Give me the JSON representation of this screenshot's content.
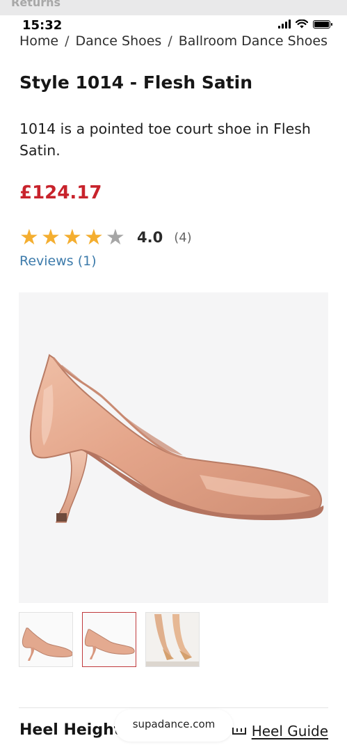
{
  "returns_banner": "Returns",
  "status_bar": {
    "time": "15:32"
  },
  "breadcrumb": {
    "items": [
      "Home",
      "Dance Shoes",
      "Ballroom Dance Shoes"
    ],
    "separator": "/"
  },
  "product": {
    "title": "Style 1014 - Flesh Satin",
    "description": "1014 is a pointed toe court shoe in Flesh Satin.",
    "price": "£124.17",
    "price_color": "#c8232c",
    "rating": {
      "value": "4.0",
      "count": "(4)",
      "stars_filled": 4,
      "stars_total": 5,
      "star_color": "#f4ae30"
    },
    "reviews_link": "Reviews (1)",
    "reviews_link_color": "#3d7bab",
    "thumbnails": [
      {
        "name": "thumb-side-left",
        "selected": false
      },
      {
        "name": "thumb-side-right",
        "selected": true
      },
      {
        "name": "thumb-dancer-feet",
        "selected": false
      }
    ]
  },
  "bottom": {
    "heel_height_label": "Heel Height",
    "heel_guide_label": "Heel Guide",
    "url_pill": "supadance.com"
  }
}
